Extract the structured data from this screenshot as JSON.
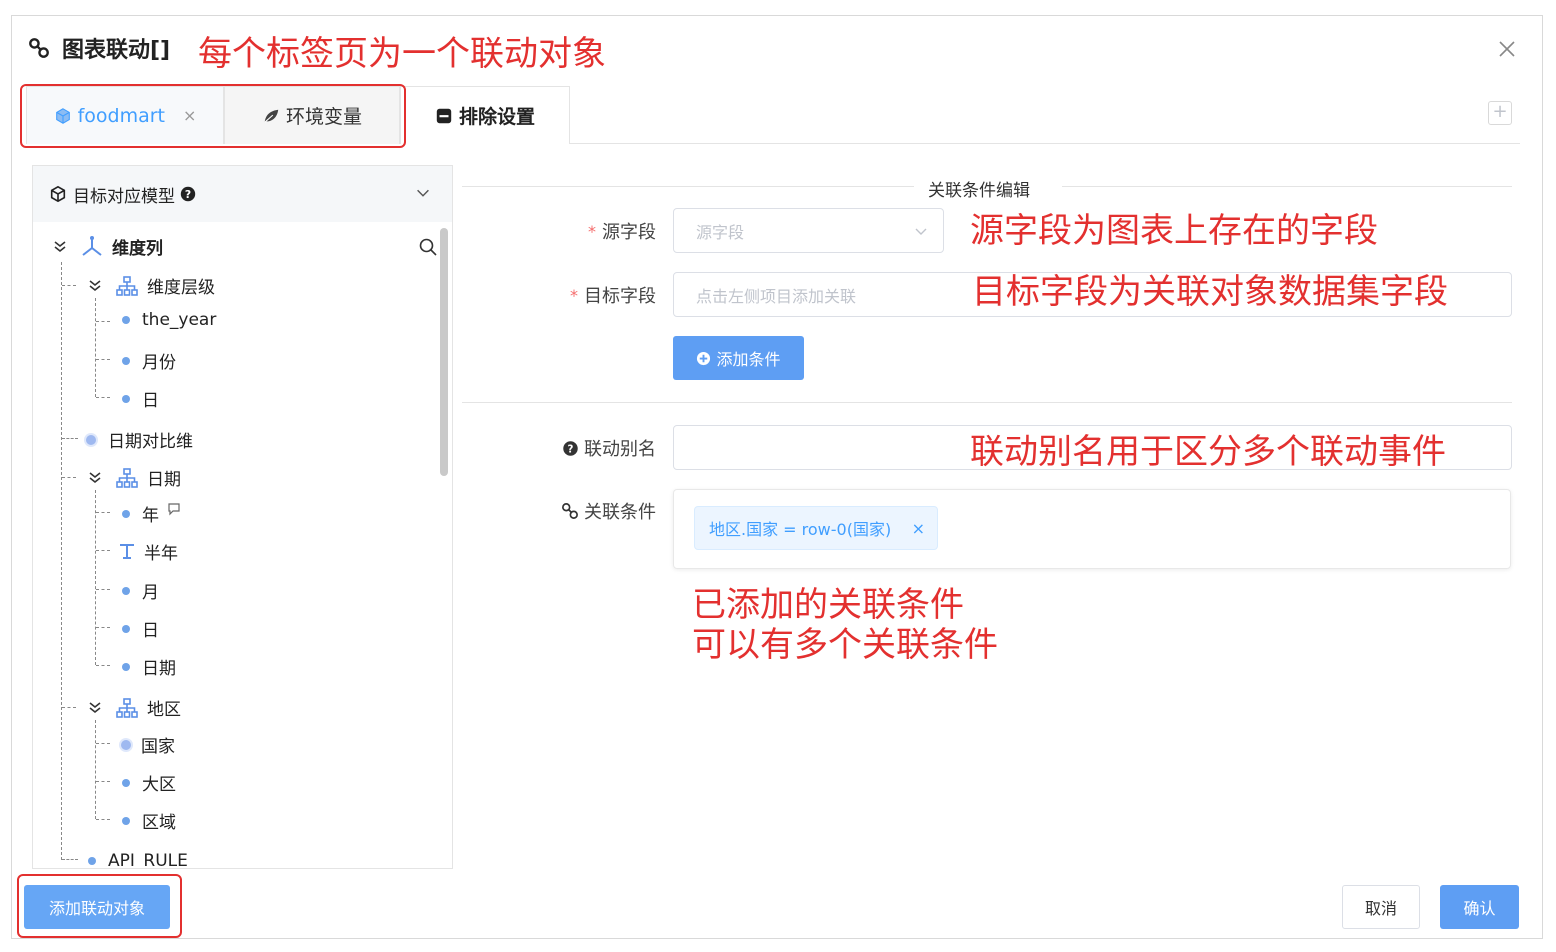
{
  "dialog": {
    "title": "图表联动[]",
    "annotation": "每个标签页为一个联动对象"
  },
  "tabs": [
    {
      "label": "foodmart",
      "close": "×"
    },
    {
      "label": "环境变量"
    },
    {
      "label": "排除设置"
    }
  ],
  "tab_add": "+",
  "tree": {
    "header": "目标对应模型",
    "nodes": {
      "dim_col": "维度列",
      "dim_hier": "维度层级",
      "the_year": "the_year",
      "month1": "月份",
      "day1": "日",
      "date_compare": "日期对比维",
      "date": "日期",
      "year": "年",
      "half_year": "半年",
      "month2": "月",
      "day2": "日",
      "date2": "日期",
      "region": "地区",
      "country": "国家",
      "big_region": "大区",
      "area": "区域",
      "api_rule": "API_RULE"
    }
  },
  "form": {
    "section_title": "关联条件编辑",
    "source_label": "源字段",
    "source_placeholder": "源字段",
    "target_label": "目标字段",
    "target_placeholder": "点击左侧项目添加关联",
    "add_condition": "添加条件",
    "alias_label": "联动别名",
    "alias_value": "",
    "conditions_label": "关联条件",
    "conditions": [
      {
        "text": "地区.国家 = row-0(国家)",
        "close": "×"
      }
    ]
  },
  "annotations": {
    "source": "源字段为图表上存在的字段",
    "target": "目标字段为关联对象数据集字段",
    "alias": "联动别名用于区分多个联动事件",
    "conditions_line1": "已添加的关联条件",
    "conditions_line2": "可以有多个关联条件"
  },
  "footer": {
    "add_target": "添加联动对象",
    "cancel": "取消",
    "confirm": "确认"
  },
  "colors": {
    "accent": "#409eff",
    "annotation": "#e3302f",
    "required": "#f56c6c"
  }
}
